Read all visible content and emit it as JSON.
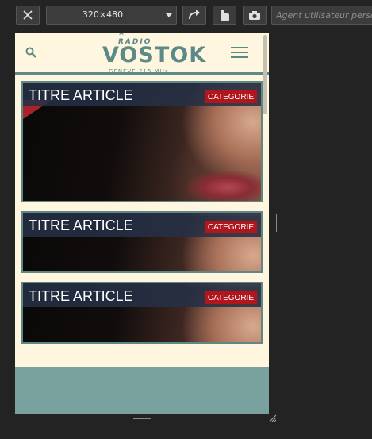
{
  "toolbar": {
    "device_size": "320×480",
    "user_agent_placeholder": "Agent utilisateur personnalisé"
  },
  "site": {
    "logo_top": "RADIO",
    "logo_main": "VOSTOK",
    "logo_sub": "GENÈVE 215 MHz"
  },
  "articles": [
    {
      "title": "TITRE ARTICLE",
      "category": "CATEGORIE"
    },
    {
      "title": "TITRE ARTICLE",
      "category": "CATEGORIE"
    },
    {
      "title": "TITRE ARTICLE",
      "category": "CATEGORIE"
    }
  ],
  "colors": {
    "brand_teal": "#5d8a89",
    "page_background": "#fef6df",
    "category_red": "#b0161b",
    "footer": "#79a29e"
  },
  "icons": [
    "close-icon",
    "rotate-icon",
    "touch-icon",
    "screenshot-icon",
    "search-icon",
    "hamburger-menu-icon"
  ]
}
